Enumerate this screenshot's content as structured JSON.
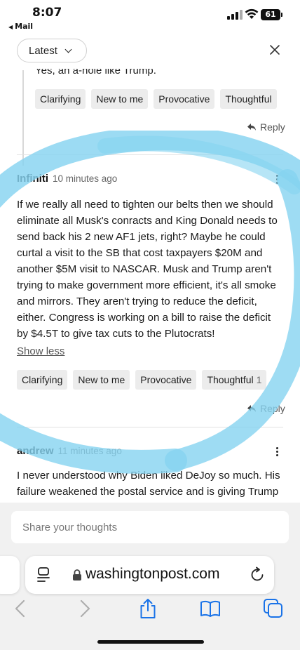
{
  "status_bar": {
    "time": "8:07",
    "back_app": "Mail",
    "battery": "61"
  },
  "header": {
    "sort_label": "Latest"
  },
  "previous_comment": {
    "text_fragment": "Yes, an a-hole like Trump.",
    "tags": [
      {
        "label": "Clarifying"
      },
      {
        "label": "New to me"
      },
      {
        "label": "Provocative"
      },
      {
        "label": "Thoughtful"
      }
    ],
    "reply_label": "Reply"
  },
  "comment_1": {
    "author": "Infiniti",
    "time": "10 minutes ago",
    "body": "If we really all need to tighten our belts then we should eliminate all Musk's conracts and King Donald needs to send back his 2 new AF1 jets, right? Maybe he could curtal a visit to the SB that cost taxpayers $20M and another $5M visit to NASCAR. Musk and Trump aren't trying to make government more efficient, it's all smoke and mirrors. They aren't trying to reduce the deficit, either. Congress is working on a bill to raise the deficit by $4.5T to give tax cuts to the Plutocrats!",
    "show_less": "Show less",
    "tags": [
      {
        "label": "Clarifying",
        "count": ""
      },
      {
        "label": "New to me",
        "count": ""
      },
      {
        "label": "Provocative",
        "count": ""
      },
      {
        "label": "Thoughtful",
        "count": "1"
      }
    ],
    "reply_label": "Reply"
  },
  "comment_2": {
    "author": "andrew",
    "time": "11 minutes ago",
    "body": "I never understood why Biden liked DeJoy so much. His failure weakened the postal service and is giving Trump"
  },
  "compose": {
    "placeholder": "Share your thoughts"
  },
  "browser": {
    "url": "washingtonpost.com"
  },
  "colors": {
    "highlight": "#86d3f0",
    "safari_blue": "#1a73e8"
  }
}
